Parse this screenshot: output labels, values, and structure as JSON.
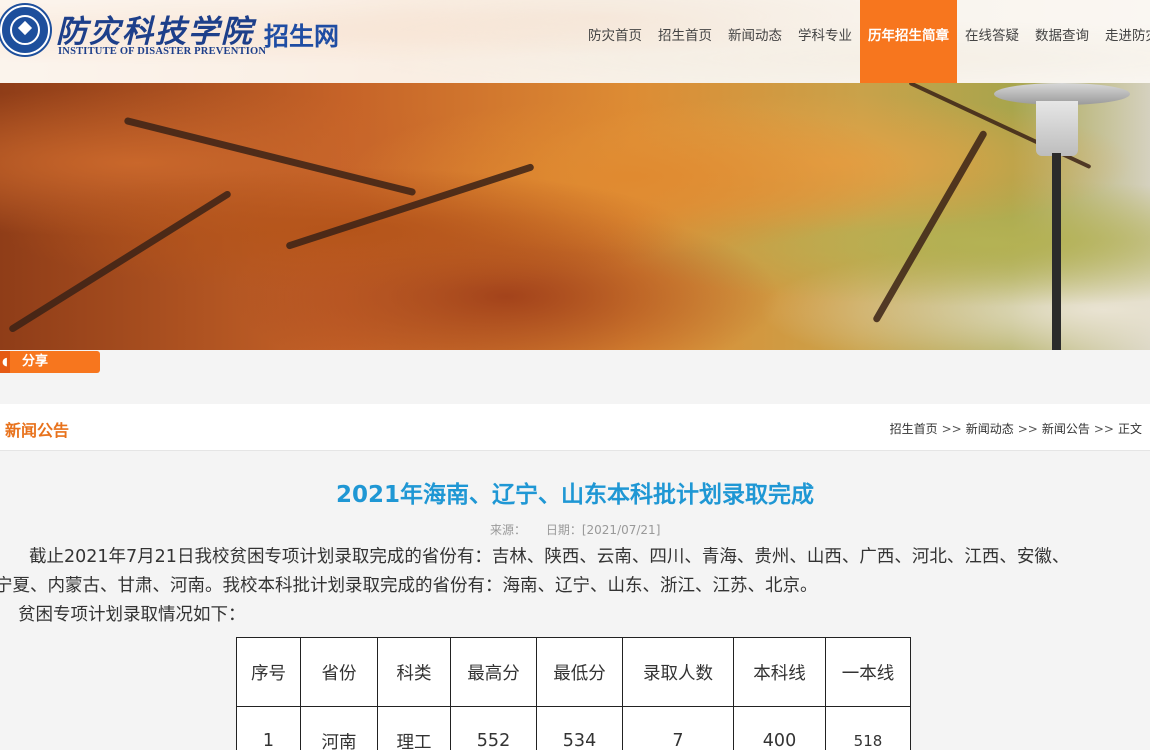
{
  "header": {
    "logo_cn": "防灾科技学院",
    "logo_en": "INSTITUTE OF DISASTER PREVENTION",
    "site_name": "招生网",
    "nav": [
      {
        "label": "防灾首页"
      },
      {
        "label": "招生首页"
      },
      {
        "label": "新闻动态"
      },
      {
        "label": "学科专业"
      },
      {
        "label": "历年招生简章",
        "active": true
      },
      {
        "label": "在线答疑"
      },
      {
        "label": "数据查询"
      },
      {
        "label": "走进防灾"
      }
    ],
    "accent_color": "#f7761e"
  },
  "share": {
    "label": "分享",
    "icon": "share-icon"
  },
  "section": {
    "title": "新闻公告",
    "breadcrumb": [
      "招生首页",
      "新闻动态",
      "新闻公告",
      "正文"
    ],
    "separator": ">>"
  },
  "article": {
    "title": "2021年海南、辽宁、山东本科批计划录取完成",
    "source_label": "来源：",
    "date_label": "日期：[2021/07/21]",
    "paragraph1_line1": "截止2021年7月21日我校贫困专项计划录取完成的省份有：吉林、陕西、云南、四川、青海、贵州、山西、广西、河北、江西、安徽、",
    "paragraph1_line2": "宁夏、内蒙古、甘肃、河南。我校本科批计划录取完成的省份有：海南、辽宁、山东、浙江、江苏、北京。",
    "paragraph2": "贫困专项计划录取情况如下：",
    "table": {
      "headers": [
        "序号",
        "省份",
        "科类",
        "最高分",
        "最低分",
        "录取人数",
        "本科线",
        "一本线"
      ],
      "rows": [
        [
          "1",
          "河南",
          "理工",
          "552",
          "534",
          "7",
          "400",
          "518"
        ]
      ]
    }
  }
}
